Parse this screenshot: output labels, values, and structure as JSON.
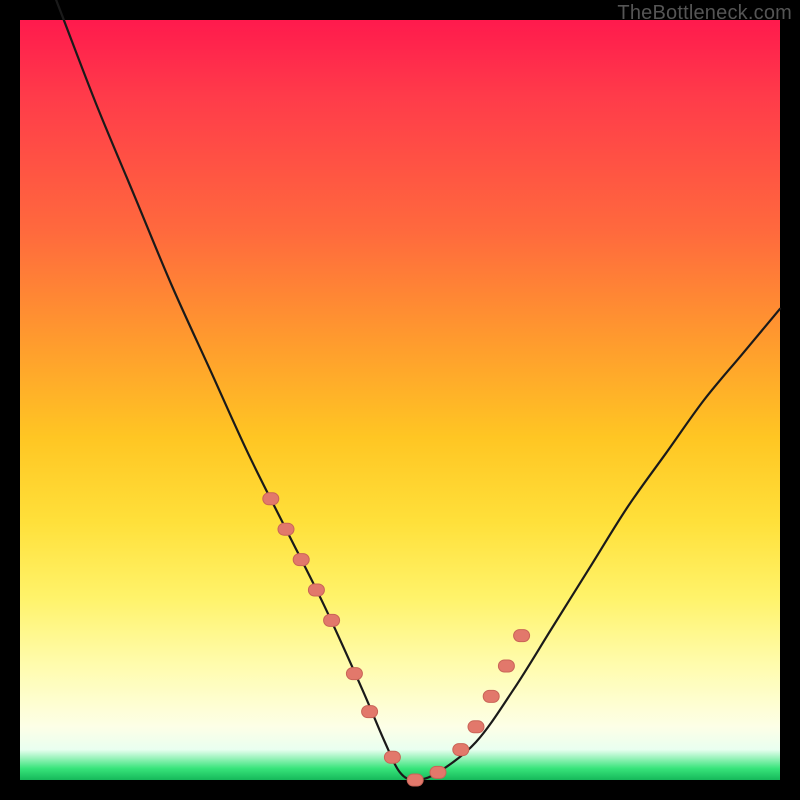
{
  "watermark": "TheBottleneck.com",
  "colors": {
    "frame_bg": "#000000",
    "curve": "#1a1a1a",
    "marker_fill": "#e2786b",
    "marker_stroke": "#c96457",
    "gradient_top": "#ff1a4d",
    "gradient_bottom": "#16b85a"
  },
  "chart_data": {
    "type": "line",
    "title": "",
    "xlabel": "",
    "ylabel": "",
    "xlim": [
      0,
      100
    ],
    "ylim": [
      0,
      100
    ],
    "grid": false,
    "legend": false,
    "series": [
      {
        "name": "bottleneck-curve",
        "x": [
          0,
          5,
          10,
          15,
          20,
          25,
          30,
          35,
          40,
          45,
          48,
          50,
          52,
          55,
          60,
          65,
          70,
          75,
          80,
          85,
          90,
          95,
          100
        ],
        "values": [
          115,
          102,
          89,
          77,
          65,
          54,
          43,
          33,
          23,
          12,
          5,
          1,
          0,
          1,
          5,
          12,
          20,
          28,
          36,
          43,
          50,
          56,
          62
        ]
      }
    ],
    "markers": {
      "name": "highlighted-points",
      "x": [
        33,
        35,
        37,
        39,
        41,
        44,
        46,
        49,
        52,
        55,
        58,
        60,
        62,
        64,
        66
      ],
      "values": [
        37,
        33,
        29,
        25,
        21,
        14,
        9,
        3,
        0,
        1,
        4,
        7,
        11,
        15,
        19
      ]
    }
  }
}
